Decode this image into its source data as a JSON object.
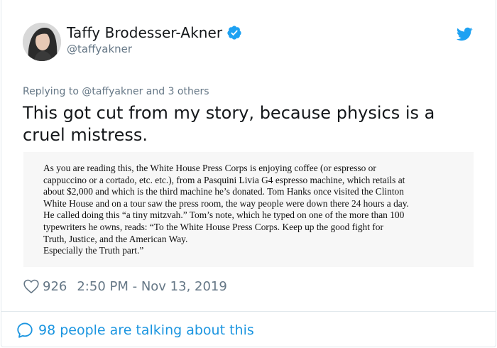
{
  "author": {
    "display_name": "Taffy Brodesser-Akner",
    "handle": "@taffyakner",
    "verified": true,
    "avatar_icon": "avatar-photo"
  },
  "reply": {
    "prefix": "Replying to",
    "mention": "@taffyakner",
    "suffix": "and 3 others"
  },
  "tweet": {
    "text_line1": "This got cut from my story, because physics is a",
    "text_line2": "cruel mistress."
  },
  "clipping": {
    "lines": [
      "As you are reading this, the White House Press Corps is enjoying coffee (or espresso or",
      "cappuccino or a cortado, etc. etc.), from a Pasquini Livia G4 espresso machine, which retails at",
      "about $2,000 and which is the third machine he’s donated. Tom Hanks once visited the Clinton",
      "White House and on a tour saw the press room, the way people were down there 24 hours a day.",
      "He called doing this “a tiny mitzvah.” Tom’s note, which he typed on one of the more than 100",
      "typewriters he owns, reads: “To the White House Press Corps. Keep up the good fight for",
      "Truth, Justice, and the American Way.",
      "Especially the Truth part.”"
    ]
  },
  "stats": {
    "likes": "926",
    "timestamp": "2:50 PM - Nov 13, 2019"
  },
  "footer": {
    "talking_label": "98 people are talking about this"
  },
  "colors": {
    "twitter_blue": "#1b95e0",
    "muted_gray": "#657786",
    "text_dark": "#14171a",
    "verified_blue": "#1da1f2"
  },
  "icons": [
    "verified-badge-icon",
    "twitter-bird-icon",
    "heart-icon",
    "speech-bubble-icon"
  ]
}
